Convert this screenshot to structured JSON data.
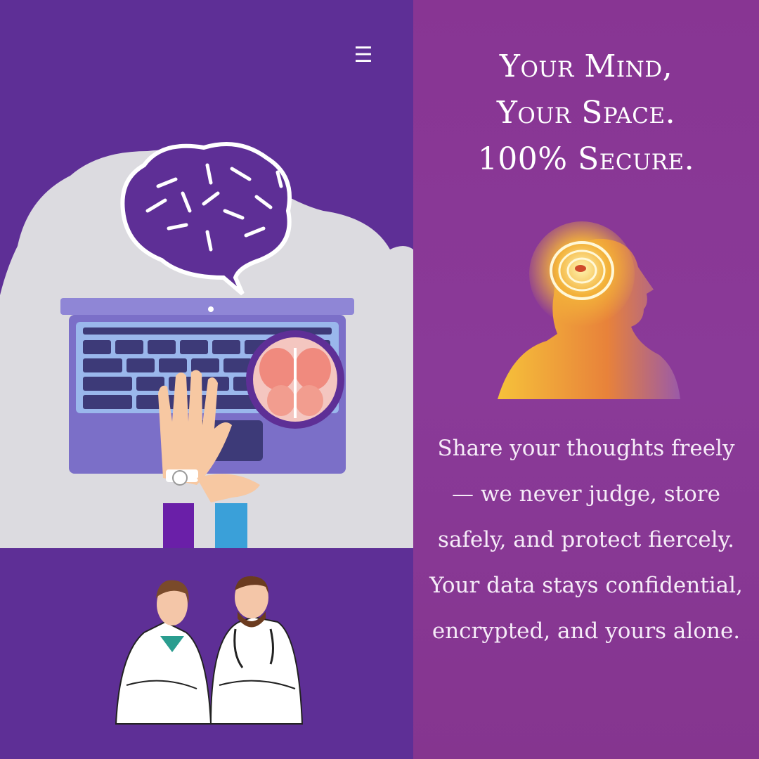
{
  "menu": {
    "icon": "hamburger-menu-icon",
    "glyph": "☰"
  },
  "headline": {
    "lines": [
      "Your Mind,",
      "Your Space.",
      "100% Secure."
    ]
  },
  "body": {
    "lines": [
      "Share your thoughts freely",
      "— we never judge, store",
      "safely, and protect fiercely.",
      "Your data stays confidential,",
      "encrypted, and yours alone."
    ]
  },
  "colors": {
    "left_background": "#5e2f96",
    "right_background": "#883593",
    "accent": "#6a2fa0",
    "text": "#ffffff"
  },
  "illustrations": {
    "laptop": "laptop-with-brain-icon",
    "head": "glowing-brain-head-icon",
    "doctors": "two-doctors-icon"
  }
}
